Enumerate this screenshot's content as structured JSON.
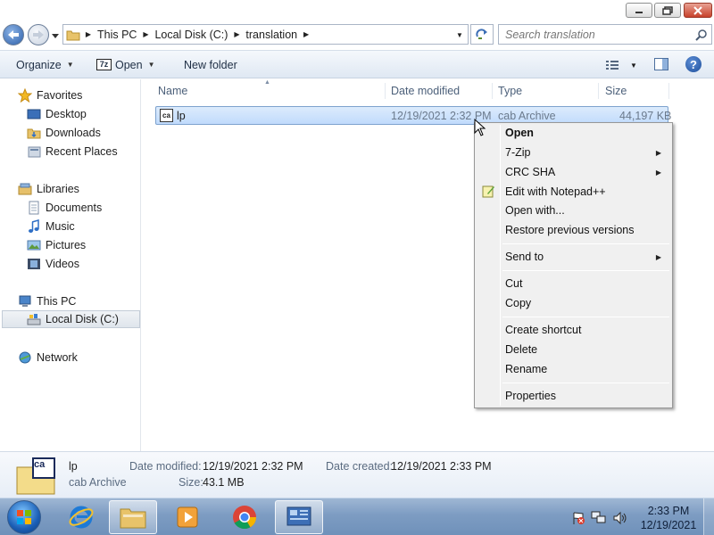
{
  "window": {
    "minimize_icon": "minimize-icon",
    "maximize_icon": "maximize-icon",
    "close_icon": "close-icon"
  },
  "address": {
    "crumbs": [
      "This PC",
      "Local Disk (C:)",
      "translation"
    ],
    "search_placeholder": "Search translation"
  },
  "toolbar": {
    "organize": "Organize",
    "open": "Open",
    "open_icon_text": "7z",
    "new_folder": "New folder"
  },
  "sidebar": {
    "items": [
      {
        "label": "Favorites",
        "icon": "star-icon"
      },
      {
        "label": "Desktop",
        "icon": "desktop-icon"
      },
      {
        "label": "Downloads",
        "icon": "downloads-folder-icon"
      },
      {
        "label": "Recent Places",
        "icon": "recent-places-icon"
      },
      {
        "label": "Libraries",
        "icon": "libraries-icon"
      },
      {
        "label": "Documents",
        "icon": "documents-icon"
      },
      {
        "label": "Music",
        "icon": "music-icon"
      },
      {
        "label": "Pictures",
        "icon": "pictures-icon"
      },
      {
        "label": "Videos",
        "icon": "videos-icon"
      },
      {
        "label": "This PC",
        "icon": "computer-icon"
      },
      {
        "label": "Local Disk (C:)",
        "icon": "drive-icon"
      },
      {
        "label": "Network",
        "icon": "network-icon"
      }
    ]
  },
  "filelist": {
    "columns": [
      "Name",
      "Date modified",
      "Type",
      "Size"
    ],
    "rows": [
      {
        "name": "lp",
        "modified": "12/19/2021 2:32 PM",
        "type": "cab Archive",
        "size": "44,197 KB",
        "icon_text": "ca"
      }
    ]
  },
  "context_menu": {
    "items": [
      {
        "label": "Open",
        "bold": true
      },
      {
        "label": "7-Zip",
        "submenu": true
      },
      {
        "label": "CRC SHA",
        "submenu": true
      },
      {
        "label": "Edit with Notepad++",
        "icon": "notepad-plus-plus-icon"
      },
      {
        "label": "Open with..."
      },
      {
        "label": "Restore previous versions"
      },
      {
        "label": "Send to",
        "submenu": true
      },
      {
        "label": "Cut"
      },
      {
        "label": "Copy"
      },
      {
        "label": "Create shortcut"
      },
      {
        "label": "Delete"
      },
      {
        "label": "Rename"
      },
      {
        "label": "Properties"
      }
    ]
  },
  "details": {
    "name": "lp",
    "type": "cab Archive",
    "icon_text": "ca",
    "modified_label": "Date modified:",
    "modified_value": "12/19/2021 2:32 PM",
    "created_label": "Date created:",
    "created_value": "12/19/2021 2:33 PM",
    "size_label": "Size:",
    "size_value": "43.1 MB"
  },
  "taskbar": {
    "apps": [
      "internet-explorer-icon",
      "file-explorer-icon",
      "media-player-icon",
      "chrome-icon",
      "control-panel-icon"
    ],
    "active_app": "control-panel-icon",
    "tray_icons": [
      "action-center-flag-icon",
      "network-status-icon",
      "volume-icon"
    ],
    "time": "2:33 PM",
    "date": "12/19/2021"
  },
  "colors": {
    "selection": "#c1dbfc",
    "taskbar": "#7d9cc2",
    "close_button": "#c7412b"
  }
}
